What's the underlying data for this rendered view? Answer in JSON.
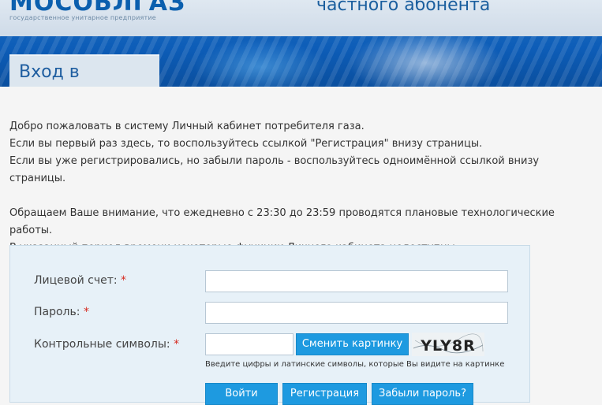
{
  "header": {
    "logo_text": "МОСОБЛГАЗ",
    "logo_subtitle": "государственное унитарное предприятие",
    "site_title": "частного абонента"
  },
  "tab": {
    "label": "Вход в систему"
  },
  "intro": {
    "lines": [
      "Добро пожаловать в систему Личный кабинет потребителя газа.",
      "Если вы первый раз здесь, то воспользуйтесь ссылкой \"Регистрация\" внизу страницы.",
      "Если вы уже регистрировались, но забыли пароль - воспользуйтесь одноимённой ссылкой внизу страницы."
    ],
    "notice": [
      "Обращаем Ваше внимание, что ежедневно с 23:30 до 23:59 проводятся плановые технологические работы.",
      "В указанный период времени некоторые функции Личного кабинета недоступны."
    ]
  },
  "form": {
    "account_label": "Лицевой счет:",
    "account_value": "",
    "password_label": "Пароль:",
    "password_value": "",
    "captcha_label": "Контрольные символы:",
    "captcha_value": "",
    "required_mark": "*",
    "change_image_button": "Сменить картинку",
    "captcha_text": "YLY8R",
    "captcha_hint": "Введите цифры и латинские символы, которые Вы видите на картинке",
    "login_button": "Войти",
    "register_button": "Регистрация",
    "forgot_button": "Забыли пароль?"
  },
  "colors": {
    "header_blue": "#0d5db8",
    "button_blue": "#1e9ae0",
    "required_red": "#d6291e",
    "panel_bg": "#e7f1f8"
  }
}
